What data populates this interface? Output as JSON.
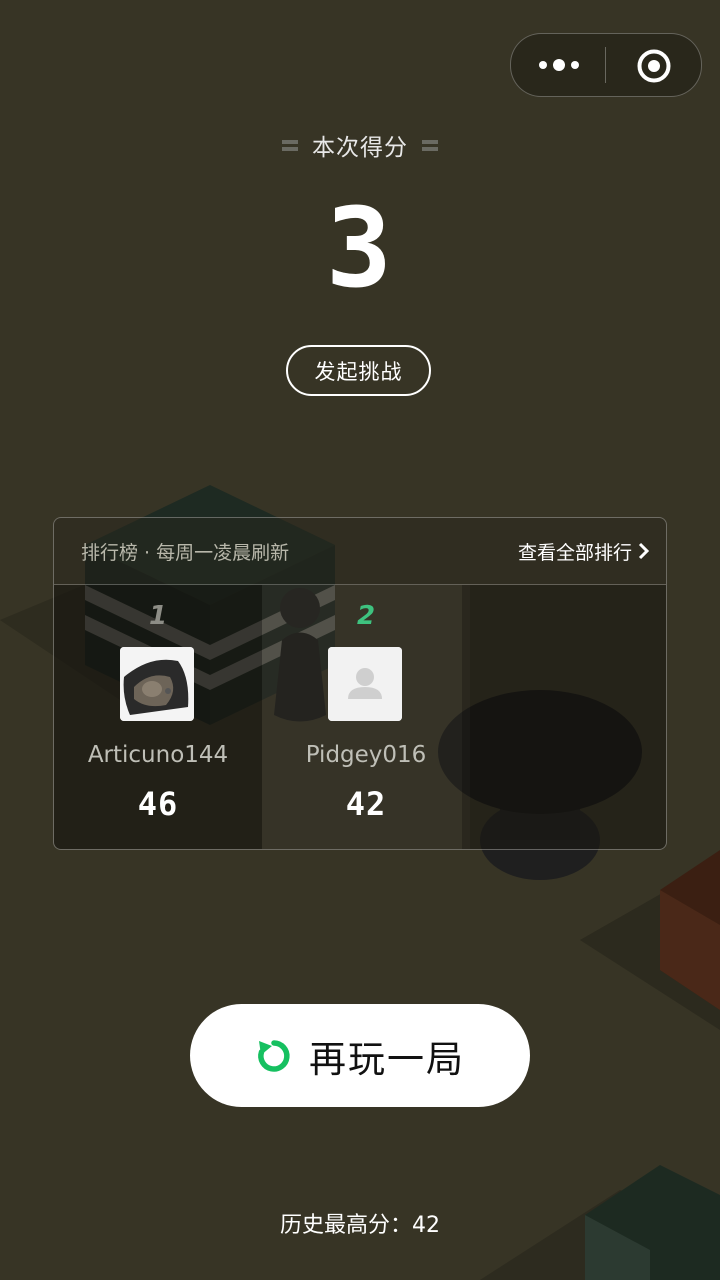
{
  "score": {
    "label": "本次得分",
    "value": "3"
  },
  "challenge_button": "发起挑战",
  "leaderboard": {
    "title": "排行榜 · 每周一凌晨刷新",
    "view_all": "查看全部排行",
    "entries": [
      {
        "rank": "1",
        "name": "Articuno144",
        "score": "46",
        "rank_color": "#8d8d86"
      },
      {
        "rank": "2",
        "name": "Pidgey016",
        "score": "42",
        "rank_color": "#3ec27f"
      }
    ]
  },
  "replay_button": "再玩一局",
  "best_score": "历史最高分：42",
  "icons": {
    "menu": "more-dots-icon",
    "close": "target-icon",
    "replay": "replay-arrow-icon",
    "chevron": "chevron-right-icon"
  },
  "colors": {
    "background": "#373425",
    "accent_green": "#16c060",
    "rank2": "#3ec27f"
  }
}
